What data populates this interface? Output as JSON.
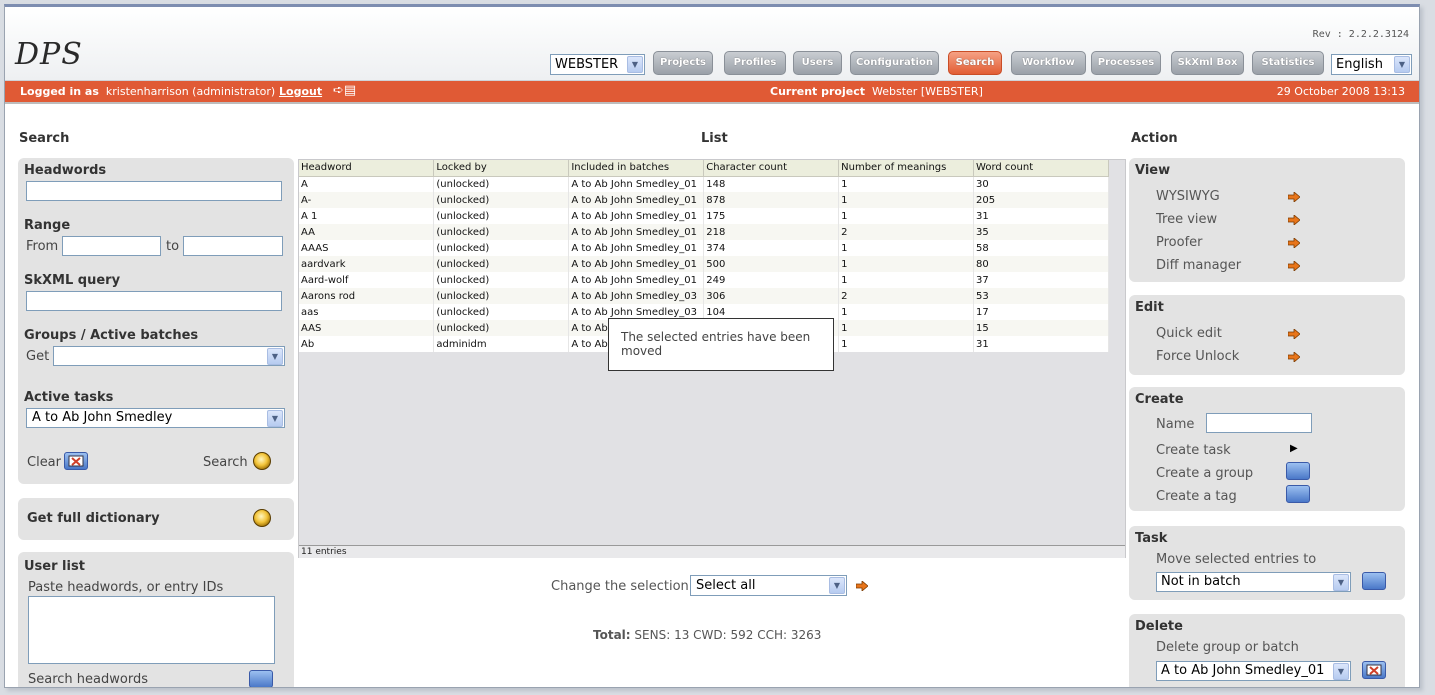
{
  "header": {
    "logo": "DPS",
    "revision": "Rev : 2.2.2.3124",
    "project_select": "WEBSTER",
    "nav": [
      "Projects",
      "Profiles",
      "Users",
      "Configuration",
      "Search",
      "Workflow",
      "Processes",
      "SkXml Box",
      "Statistics"
    ],
    "active_nav": "Search",
    "language": "English"
  },
  "status": {
    "logged_label": "Logged in as",
    "user": "kristenharrison (administrator)",
    "logout": "Logout",
    "current_project_label": "Current project",
    "current_project": "Webster [WEBSTER]",
    "datetime": "29 October 2008 13:13"
  },
  "columns": {
    "search": "Search",
    "list": "List",
    "action": "Action"
  },
  "search": {
    "headwords_label": "Headwords",
    "range_label": "Range",
    "from_label": "From",
    "to_label": "to",
    "skxml_label": "SkXML query",
    "groups_label": "Groups / Active batches",
    "get_label": "Get",
    "tasks_label": "Active tasks",
    "tasks_value": "A to Ab John Smedley",
    "clear_label": "Clear",
    "search_label": "Search",
    "full_dict_label": "Get full dictionary",
    "userlist_label": "User list",
    "paste_label": "Paste headwords, or entry IDs",
    "search_headwords_label": "Search headwords"
  },
  "list": {
    "headers": [
      "Headword",
      "Locked by",
      "Included in batches",
      "Character count",
      "Number of meanings",
      "Word count"
    ],
    "rows": [
      [
        "A",
        "(unlocked)",
        "A to Ab John Smedley_01",
        "148",
        "1",
        "30"
      ],
      [
        "A-",
        "(unlocked)",
        "A to Ab John Smedley_01",
        "878",
        "1",
        "205"
      ],
      [
        "A 1",
        "(unlocked)",
        "A to Ab John Smedley_01",
        "175",
        "1",
        "31"
      ],
      [
        "AA",
        "(unlocked)",
        "A to Ab John Smedley_01",
        "218",
        "2",
        "35"
      ],
      [
        "AAAS",
        "(unlocked)",
        "A to Ab John Smedley_01",
        "374",
        "1",
        "58"
      ],
      [
        "aardvark",
        "(unlocked)",
        "A to Ab John Smedley_01",
        "500",
        "1",
        "80"
      ],
      [
        "Aard-wolf",
        "(unlocked)",
        "A to Ab John Smedley_01",
        "249",
        "1",
        "37"
      ],
      [
        "Aarons rod",
        "(unlocked)",
        "A to Ab John Smedley_03",
        "306",
        "2",
        "53"
      ],
      [
        "aas",
        "(unlocked)",
        "A to Ab John Smedley_03",
        "104",
        "1",
        "17"
      ],
      [
        "AAS",
        "(unlocked)",
        "A to Ab",
        "",
        "1",
        "15"
      ],
      [
        "Ab",
        "adminidm",
        "A to Ab",
        "",
        "1",
        "31"
      ]
    ],
    "entries": "11 entries",
    "tooltip": "The selected entries have been moved",
    "change_label": "Change the selection",
    "change_value": "Select all",
    "total_label": "Total:",
    "total_value": "SENS: 13 CWD: 592 CCH: 3263"
  },
  "action": {
    "view_title": "View",
    "view_items": [
      "WYSIWYG",
      "Tree view",
      "Proofer",
      "Diff manager"
    ],
    "edit_title": "Edit",
    "edit_items": [
      "Quick edit",
      "Force Unlock"
    ],
    "create_title": "Create",
    "name_label": "Name",
    "create_task": "Create task",
    "create_group": "Create a group",
    "create_tag": "Create a tag",
    "task_title": "Task",
    "move_label": "Move selected entries to",
    "move_value": "Not in batch",
    "delete_title": "Delete",
    "delete_label": "Delete group or batch",
    "delete_value": "A to Ab John Smedley_01"
  },
  "colors": {
    "accent": "#e05a35",
    "panel": "#e3e3e3",
    "nav": "#9aa0a8"
  }
}
